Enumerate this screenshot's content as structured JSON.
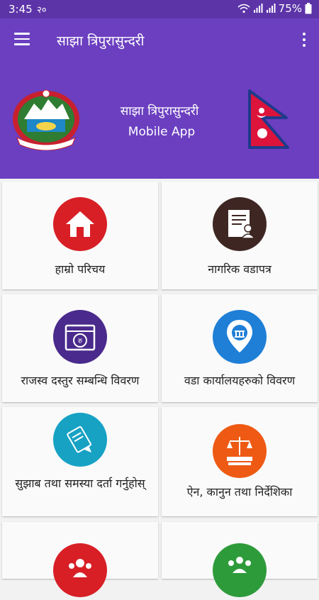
{
  "status_bar": {
    "time": "3:45",
    "notification": "२०",
    "battery": "75%"
  },
  "app_bar": {
    "title": "साझा त्रिपुरासुन्दरी"
  },
  "header": {
    "title": "साझा त्रिपुरासुन्दरी",
    "subtitle": "Mobile App"
  },
  "colors": {
    "primary": "#6b3fc0",
    "status": "#5c34a8"
  },
  "menu": [
    {
      "label": "हाम्रो परिचय",
      "icon": "home-icon",
      "color": "#d81f26"
    },
    {
      "label": "नागरिक वडापत्र",
      "icon": "citizen-charter-icon",
      "color": "#3e2723"
    },
    {
      "label": "राजस्व दस्तुर सम्बन्धि विवरण",
      "icon": "revenue-icon",
      "color": "#4a2a8c"
    },
    {
      "label": "वडा कार्यालयहरुको विवरण",
      "icon": "ward-office-location-icon",
      "color": "#1f7fd6"
    },
    {
      "label": "सुझाब तथा समस्या दर्ता गर्नुहोस्",
      "icon": "suggestion-icon",
      "color": "#17a2c4"
    },
    {
      "label": "ऐन, कानुन तथा निर्देशिका",
      "icon": "law-icon",
      "color": "#ee5a14"
    },
    {
      "label": "",
      "icon": "people-icon",
      "color": "#d81f26"
    },
    {
      "label": "",
      "icon": "group-icon",
      "color": "#2e9b3b"
    }
  ]
}
